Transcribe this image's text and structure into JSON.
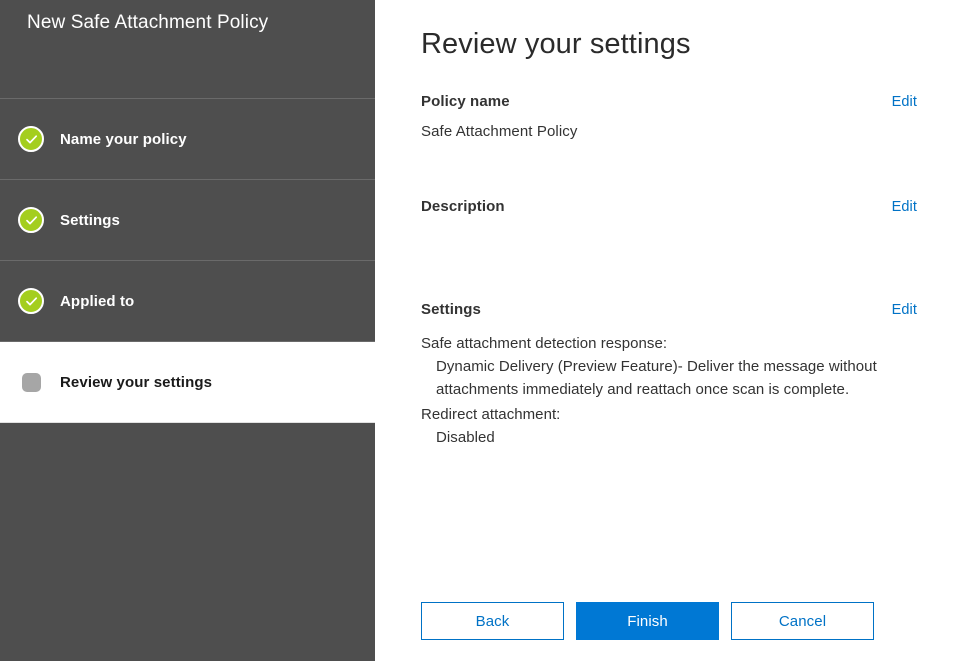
{
  "sidebar": {
    "title": "New Safe Attachment Policy",
    "steps": [
      {
        "label": "Name your policy",
        "state": "complete",
        "icon": "check-circle-icon"
      },
      {
        "label": "Settings",
        "state": "complete",
        "icon": "check-circle-icon"
      },
      {
        "label": "Applied to",
        "state": "complete",
        "icon": "check-circle-icon"
      },
      {
        "label": "Review your settings",
        "state": "current",
        "icon": "pending-dot-icon"
      }
    ]
  },
  "main": {
    "heading": "Review your settings",
    "sections": [
      {
        "title": "Policy name",
        "edit_label": "Edit",
        "value": "Safe Attachment Policy"
      },
      {
        "title": "Description",
        "edit_label": "Edit",
        "value": ""
      },
      {
        "title": "Settings",
        "edit_label": "Edit",
        "settings": [
          {
            "label": "Safe attachment detection response:",
            "detail": "Dynamic Delivery (Preview Feature)- Deliver the message without attachments immediately and reattach once scan is complete."
          },
          {
            "label": "Redirect attachment:",
            "detail": "Disabled"
          }
        ]
      }
    ],
    "buttons": {
      "back": "Back",
      "finish": "Finish",
      "cancel": "Cancel"
    }
  },
  "colors": {
    "sidebar_background": "#4e4e4e",
    "step_complete_green": "#a4ce1e",
    "step_pending_gray": "#a6a6a6",
    "link_blue": "#0072c6",
    "primary_button_blue": "#0078d4",
    "text_dark": "#333333"
  }
}
